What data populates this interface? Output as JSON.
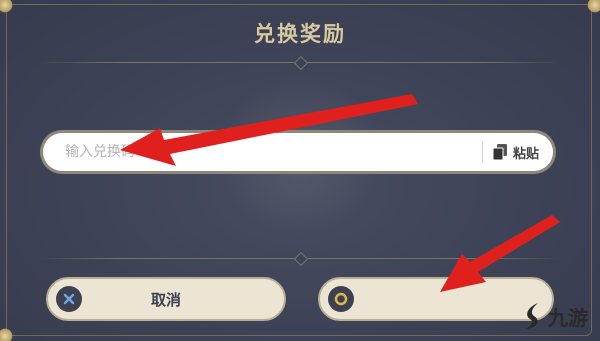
{
  "dialog": {
    "title": "兑换奖励"
  },
  "redeem": {
    "placeholder": "输入兑换码",
    "paste_label": "粘贴"
  },
  "buttons": {
    "cancel_label": "取消",
    "confirm_label": ""
  },
  "watermark": {
    "logo_text": "九游"
  },
  "colors": {
    "panel": "#3d4256",
    "title": "#d8c89f",
    "button_bg": "#ece5d3",
    "button_text": "#3d4151",
    "arrow": "#e0201c",
    "cancel_icon": "#6ea7e6",
    "confirm_icon": "#e0b84a"
  }
}
